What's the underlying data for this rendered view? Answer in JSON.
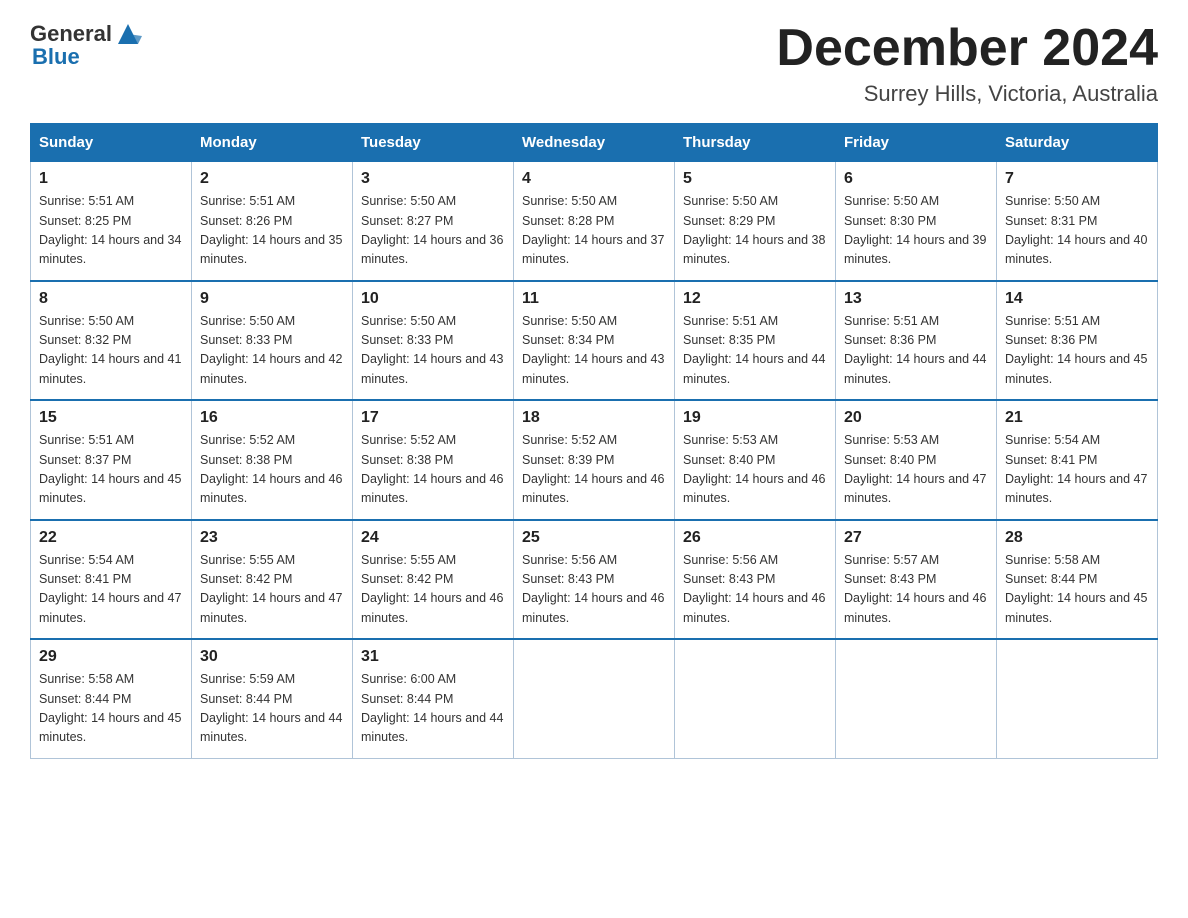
{
  "header": {
    "logo_general": "General",
    "logo_blue": "Blue",
    "month": "December 2024",
    "location": "Surrey Hills, Victoria, Australia"
  },
  "days_of_week": [
    "Sunday",
    "Monday",
    "Tuesday",
    "Wednesday",
    "Thursday",
    "Friday",
    "Saturday"
  ],
  "weeks": [
    [
      {
        "day": "1",
        "sunrise": "5:51 AM",
        "sunset": "8:25 PM",
        "daylight": "14 hours and 34 minutes."
      },
      {
        "day": "2",
        "sunrise": "5:51 AM",
        "sunset": "8:26 PM",
        "daylight": "14 hours and 35 minutes."
      },
      {
        "day": "3",
        "sunrise": "5:50 AM",
        "sunset": "8:27 PM",
        "daylight": "14 hours and 36 minutes."
      },
      {
        "day": "4",
        "sunrise": "5:50 AM",
        "sunset": "8:28 PM",
        "daylight": "14 hours and 37 minutes."
      },
      {
        "day": "5",
        "sunrise": "5:50 AM",
        "sunset": "8:29 PM",
        "daylight": "14 hours and 38 minutes."
      },
      {
        "day": "6",
        "sunrise": "5:50 AM",
        "sunset": "8:30 PM",
        "daylight": "14 hours and 39 minutes."
      },
      {
        "day": "7",
        "sunrise": "5:50 AM",
        "sunset": "8:31 PM",
        "daylight": "14 hours and 40 minutes."
      }
    ],
    [
      {
        "day": "8",
        "sunrise": "5:50 AM",
        "sunset": "8:32 PM",
        "daylight": "14 hours and 41 minutes."
      },
      {
        "day": "9",
        "sunrise": "5:50 AM",
        "sunset": "8:33 PM",
        "daylight": "14 hours and 42 minutes."
      },
      {
        "day": "10",
        "sunrise": "5:50 AM",
        "sunset": "8:33 PM",
        "daylight": "14 hours and 43 minutes."
      },
      {
        "day": "11",
        "sunrise": "5:50 AM",
        "sunset": "8:34 PM",
        "daylight": "14 hours and 43 minutes."
      },
      {
        "day": "12",
        "sunrise": "5:51 AM",
        "sunset": "8:35 PM",
        "daylight": "14 hours and 44 minutes."
      },
      {
        "day": "13",
        "sunrise": "5:51 AM",
        "sunset": "8:36 PM",
        "daylight": "14 hours and 44 minutes."
      },
      {
        "day": "14",
        "sunrise": "5:51 AM",
        "sunset": "8:36 PM",
        "daylight": "14 hours and 45 minutes."
      }
    ],
    [
      {
        "day": "15",
        "sunrise": "5:51 AM",
        "sunset": "8:37 PM",
        "daylight": "14 hours and 45 minutes."
      },
      {
        "day": "16",
        "sunrise": "5:52 AM",
        "sunset": "8:38 PM",
        "daylight": "14 hours and 46 minutes."
      },
      {
        "day": "17",
        "sunrise": "5:52 AM",
        "sunset": "8:38 PM",
        "daylight": "14 hours and 46 minutes."
      },
      {
        "day": "18",
        "sunrise": "5:52 AM",
        "sunset": "8:39 PM",
        "daylight": "14 hours and 46 minutes."
      },
      {
        "day": "19",
        "sunrise": "5:53 AM",
        "sunset": "8:40 PM",
        "daylight": "14 hours and 46 minutes."
      },
      {
        "day": "20",
        "sunrise": "5:53 AM",
        "sunset": "8:40 PM",
        "daylight": "14 hours and 47 minutes."
      },
      {
        "day": "21",
        "sunrise": "5:54 AM",
        "sunset": "8:41 PM",
        "daylight": "14 hours and 47 minutes."
      }
    ],
    [
      {
        "day": "22",
        "sunrise": "5:54 AM",
        "sunset": "8:41 PM",
        "daylight": "14 hours and 47 minutes."
      },
      {
        "day": "23",
        "sunrise": "5:55 AM",
        "sunset": "8:42 PM",
        "daylight": "14 hours and 47 minutes."
      },
      {
        "day": "24",
        "sunrise": "5:55 AM",
        "sunset": "8:42 PM",
        "daylight": "14 hours and 46 minutes."
      },
      {
        "day": "25",
        "sunrise": "5:56 AM",
        "sunset": "8:43 PM",
        "daylight": "14 hours and 46 minutes."
      },
      {
        "day": "26",
        "sunrise": "5:56 AM",
        "sunset": "8:43 PM",
        "daylight": "14 hours and 46 minutes."
      },
      {
        "day": "27",
        "sunrise": "5:57 AM",
        "sunset": "8:43 PM",
        "daylight": "14 hours and 46 minutes."
      },
      {
        "day": "28",
        "sunrise": "5:58 AM",
        "sunset": "8:44 PM",
        "daylight": "14 hours and 45 minutes."
      }
    ],
    [
      {
        "day": "29",
        "sunrise": "5:58 AM",
        "sunset": "8:44 PM",
        "daylight": "14 hours and 45 minutes."
      },
      {
        "day": "30",
        "sunrise": "5:59 AM",
        "sunset": "8:44 PM",
        "daylight": "14 hours and 44 minutes."
      },
      {
        "day": "31",
        "sunrise": "6:00 AM",
        "sunset": "8:44 PM",
        "daylight": "14 hours and 44 minutes."
      },
      null,
      null,
      null,
      null
    ]
  ]
}
